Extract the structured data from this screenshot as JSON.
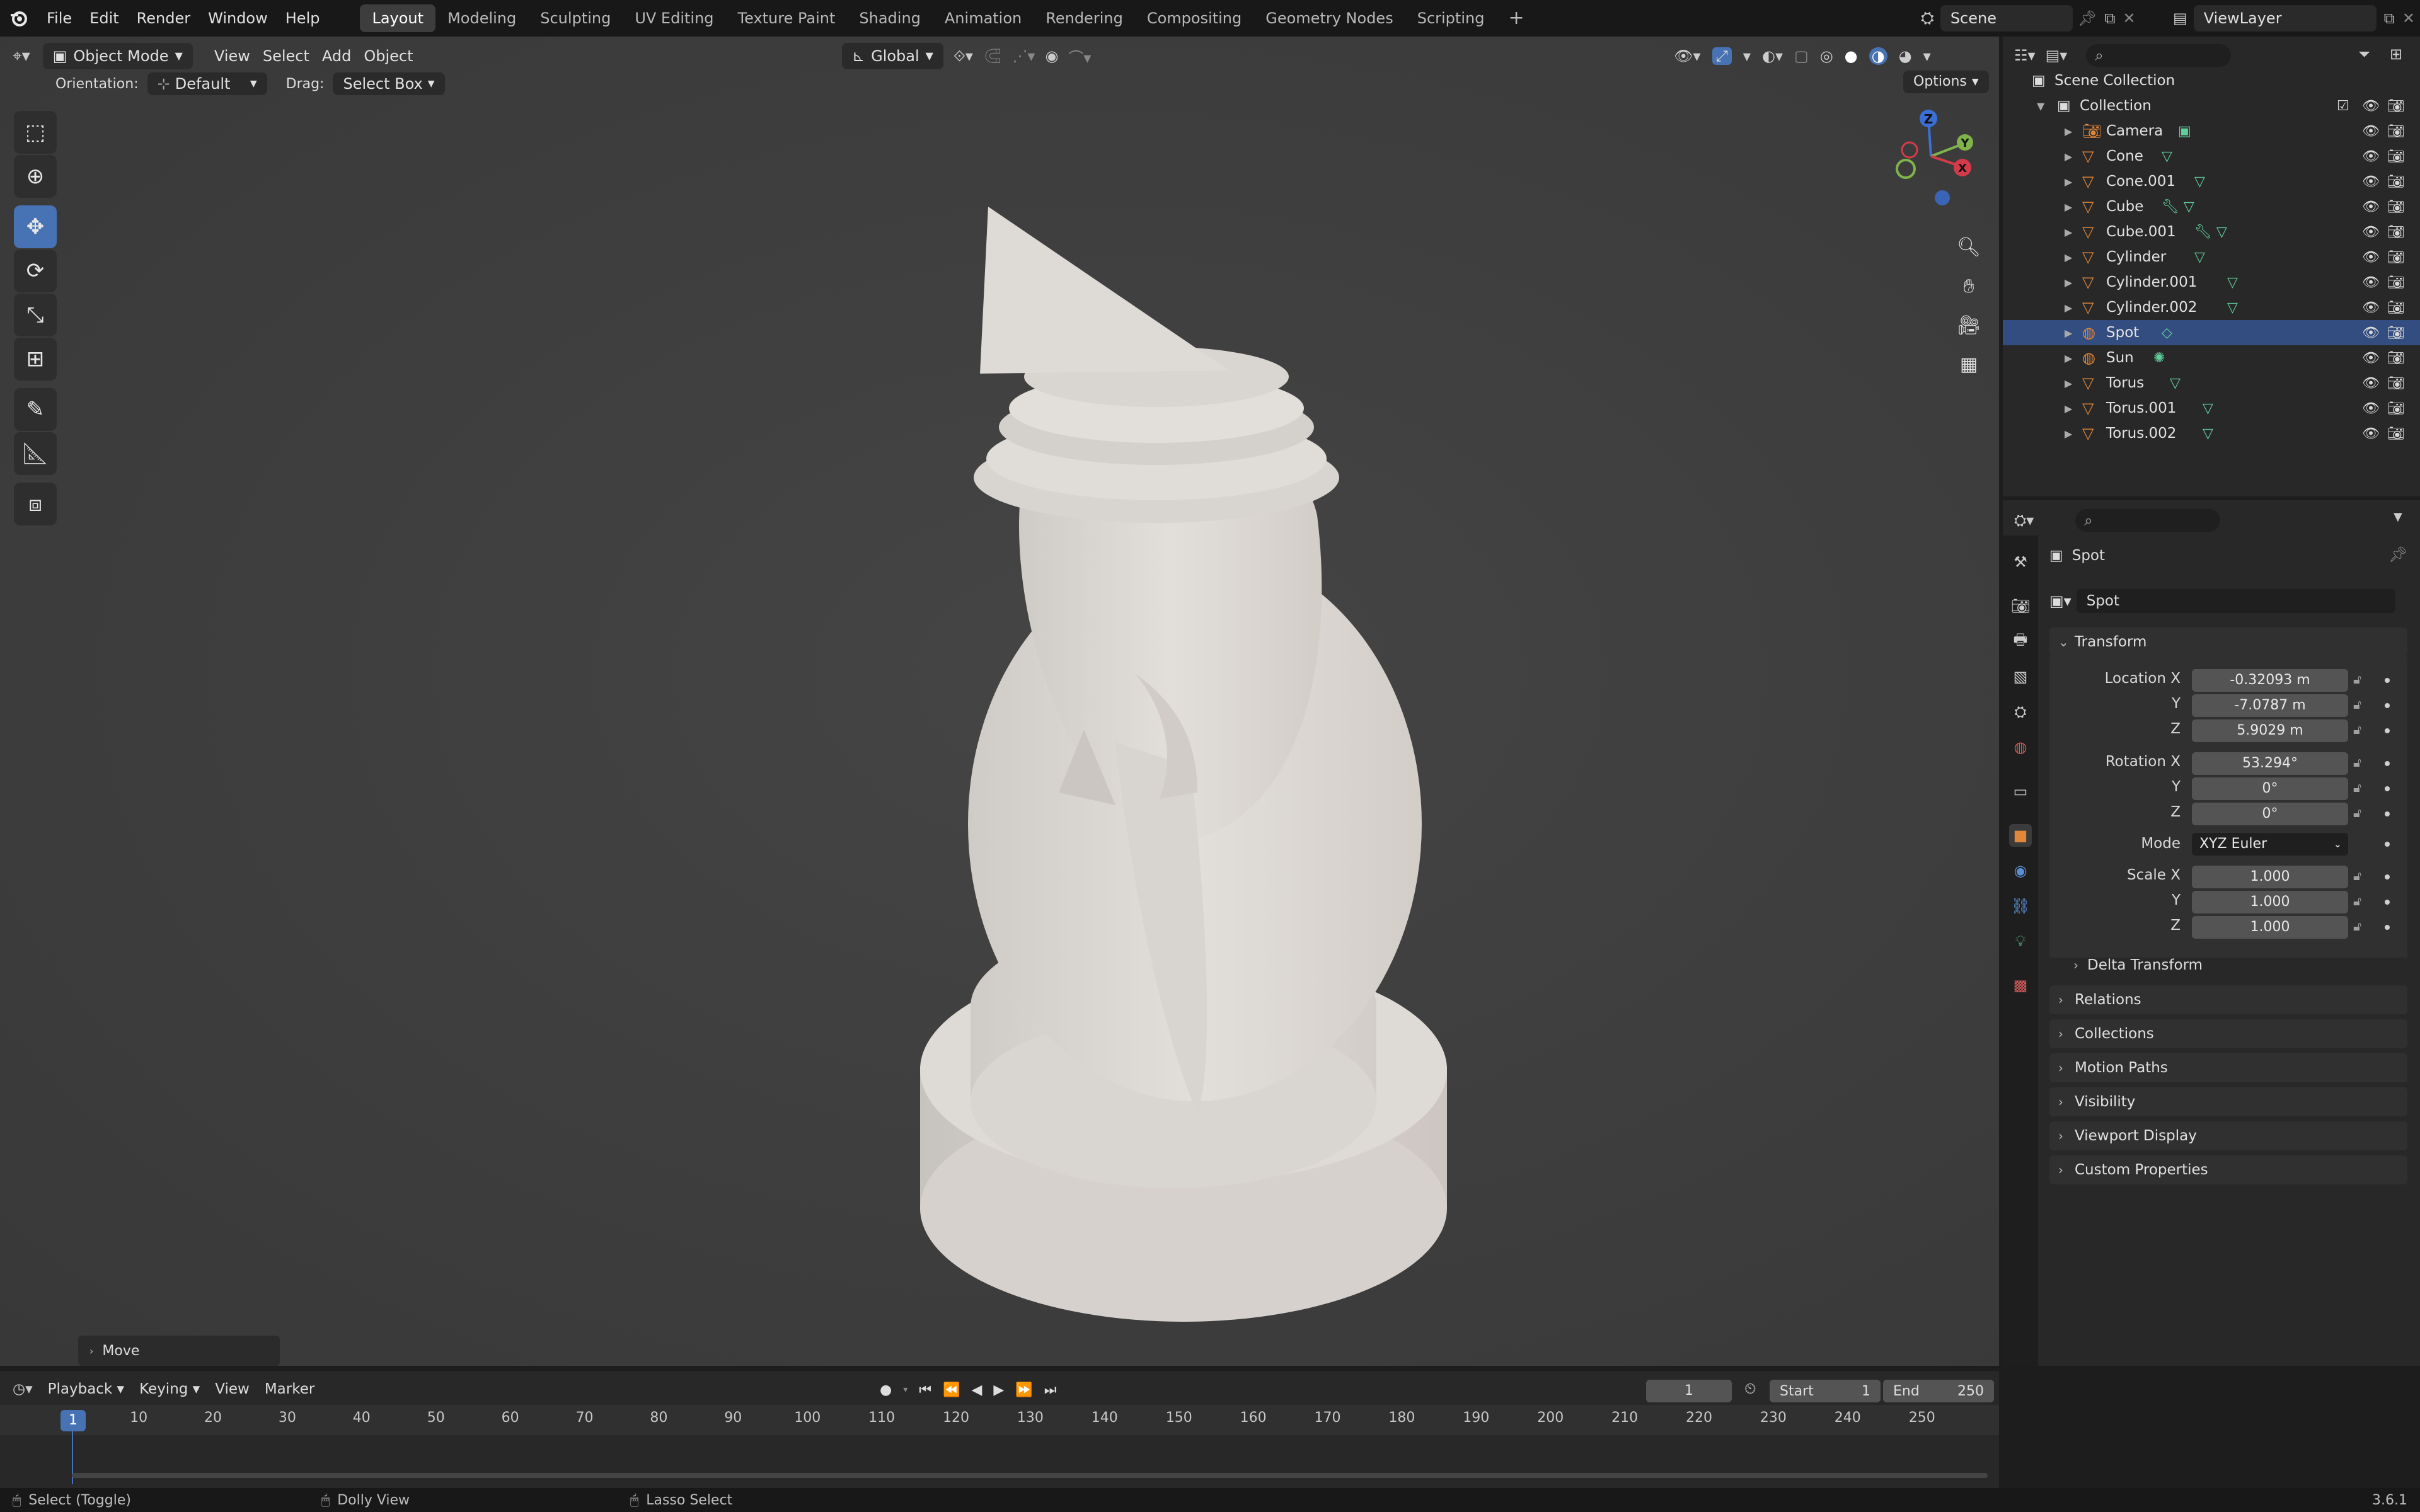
{
  "menubar": {
    "menus": [
      "File",
      "Edit",
      "Render",
      "Window",
      "Help"
    ],
    "workspaces": [
      "Layout",
      "Modeling",
      "Sculpting",
      "UV Editing",
      "Texture Paint",
      "Shading",
      "Animation",
      "Rendering",
      "Compositing",
      "Geometry Nodes",
      "Scripting"
    ],
    "active_workspace": "Layout",
    "add_tab": "+",
    "scene": "Scene",
    "view_layer": "ViewLayer"
  },
  "viewport_header": {
    "mode": "Object Mode",
    "menus": [
      "View",
      "Select",
      "Add",
      "Object"
    ],
    "transform_orientation": "Global",
    "orientation_label": "Orientation:",
    "orientation_value": "Default",
    "drag_label": "Drag:",
    "drag_value": "Select Box",
    "options": "Options"
  },
  "gizmo": {
    "z": "Z",
    "y": "Y",
    "x": "X"
  },
  "last_operator": "Move",
  "outliner": {
    "root": "Scene Collection",
    "collection": "Collection",
    "objects": [
      {
        "name": "Camera",
        "kind": "camera",
        "selected": false
      },
      {
        "name": "Cone",
        "kind": "mesh",
        "selected": false
      },
      {
        "name": "Cone.001",
        "kind": "mesh",
        "selected": false
      },
      {
        "name": "Cube",
        "kind": "mesh-mod",
        "selected": false
      },
      {
        "name": "Cube.001",
        "kind": "mesh-mod",
        "selected": false
      },
      {
        "name": "Cylinder",
        "kind": "mesh",
        "selected": false
      },
      {
        "name": "Cylinder.001",
        "kind": "mesh",
        "selected": false
      },
      {
        "name": "Cylinder.002",
        "kind": "mesh",
        "selected": false
      },
      {
        "name": "Spot",
        "kind": "light",
        "selected": true
      },
      {
        "name": "Sun",
        "kind": "light",
        "selected": false
      },
      {
        "name": "Torus",
        "kind": "mesh",
        "selected": false
      },
      {
        "name": "Torus.001",
        "kind": "mesh",
        "selected": false
      },
      {
        "name": "Torus.002",
        "kind": "mesh",
        "selected": false
      }
    ]
  },
  "properties": {
    "object_name": "Spot",
    "datablock_name": "Spot",
    "transform_title": "Transform",
    "location_label": "Location X",
    "location": [
      "-0.32093 m",
      "-7.0787 m",
      "5.9029 m"
    ],
    "rotation_label": "Rotation X",
    "rotation": [
      "53.294°",
      "0°",
      "0°"
    ],
    "mode_label": "Mode",
    "mode_value": "XYZ Euler",
    "scale_label": "Scale X",
    "scale": [
      "1.000",
      "1.000",
      "1.000"
    ],
    "axis_y": "Y",
    "axis_z": "Z",
    "delta": "Delta Transform",
    "panels": [
      "Relations",
      "Collections",
      "Motion Paths",
      "Visibility",
      "Viewport Display",
      "Custom Properties"
    ]
  },
  "timeline": {
    "menus": [
      "Playback",
      "Keying",
      "View",
      "Marker"
    ],
    "current_frame": "1",
    "start_label": "Start",
    "start": "1",
    "end_label": "End",
    "end": "250",
    "ticks": [
      "1",
      "10",
      "20",
      "30",
      "40",
      "50",
      "60",
      "70",
      "80",
      "90",
      "100",
      "110",
      "120",
      "130",
      "140",
      "150",
      "160",
      "170",
      "180",
      "190",
      "200",
      "210",
      "220",
      "230",
      "240",
      "250"
    ]
  },
  "statusbar": {
    "left": "Select (Toggle)",
    "middle": "Dolly View",
    "right": "Lasso Select",
    "version": "3.6.1"
  },
  "colors": {
    "accent": "#4772b3",
    "selection": "#334d80",
    "object_orange": "#e0873a",
    "mesh_green": "#5fcf9b"
  }
}
